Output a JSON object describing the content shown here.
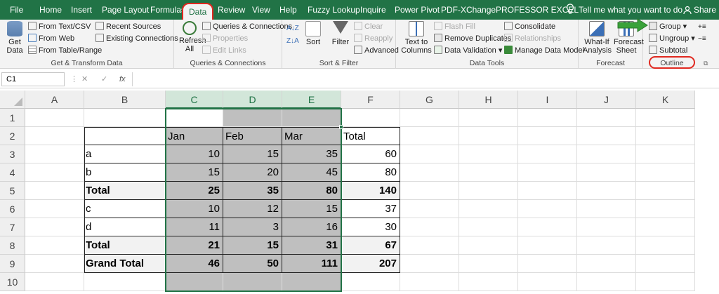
{
  "menubar": {
    "tabs": [
      "File",
      "Home",
      "Insert",
      "Page Layout",
      "Formulas",
      "Data",
      "Review",
      "View",
      "Help",
      "Fuzzy Lookup",
      "Inquire",
      "Power Pivot",
      "PDF-XChange",
      "PROFESSOR EXCEL"
    ],
    "tell_me": "Tell me what you want to do",
    "share": "Share"
  },
  "ribbon": {
    "get_transform": {
      "get_data": "Get Data",
      "from_text_csv": "From Text/CSV",
      "from_web": "From Web",
      "from_table_range": "From Table/Range",
      "recent_sources": "Recent Sources",
      "existing_connections": "Existing Connections",
      "label": "Get & Transform Data"
    },
    "queries": {
      "refresh_all": "Refresh All",
      "queries_connections": "Queries & Connections",
      "properties": "Properties",
      "edit_links": "Edit Links",
      "label": "Queries & Connections"
    },
    "sort_filter": {
      "sort": "Sort",
      "filter": "Filter",
      "clear": "Clear",
      "reapply": "Reapply",
      "advanced": "Advanced",
      "label": "Sort & Filter"
    },
    "data_tools": {
      "text_to_columns": "Text to Columns",
      "flash_fill": "Flash Fill",
      "remove_duplicates": "Remove Duplicates",
      "data_validation": "Data Validation",
      "consolidate": "Consolidate",
      "relationships": "Relationships",
      "manage_data_model": "Manage Data Model",
      "label": "Data Tools"
    },
    "forecast": {
      "what_if": "What-If Analysis",
      "forecast_sheet": "Forecast Sheet",
      "label": "Forecast"
    },
    "outline": {
      "group": "Group",
      "ungroup": "Ungroup",
      "subtotal": "Subtotal",
      "label": "Outline"
    }
  },
  "formula_bar": {
    "name_box": "C1",
    "fx": "fx",
    "content": ""
  },
  "columns": [
    "A",
    "B",
    "C",
    "D",
    "E",
    "F",
    "G",
    "H",
    "I",
    "J",
    "K"
  ],
  "rows": [
    "1",
    "2",
    "3",
    "4",
    "5",
    "6",
    "7",
    "8",
    "9",
    "10"
  ],
  "table": {
    "header": [
      "",
      "Jan",
      "Feb",
      "Mar",
      "Total"
    ],
    "rows": [
      {
        "label": "a",
        "jan": "10",
        "feb": "15",
        "mar": "35",
        "total": "60",
        "bold": false
      },
      {
        "label": "b",
        "jan": "15",
        "feb": "20",
        "mar": "45",
        "total": "80",
        "bold": false
      },
      {
        "label": "Total",
        "jan": "25",
        "feb": "35",
        "mar": "80",
        "total": "140",
        "bold": true
      },
      {
        "label": "c",
        "jan": "10",
        "feb": "12",
        "mar": "15",
        "total": "37",
        "bold": false
      },
      {
        "label": "d",
        "jan": "11",
        "feb": "3",
        "mar": "16",
        "total": "30",
        "bold": false
      },
      {
        "label": "Total",
        "jan": "21",
        "feb": "15",
        "mar": "31",
        "total": "67",
        "bold": true
      },
      {
        "label": "Grand Total",
        "jan": "46",
        "feb": "50",
        "mar": "111",
        "total": "207",
        "bold": true
      }
    ]
  },
  "colors": {
    "excel_green": "#217346",
    "highlight_red": "#e0281f",
    "selection_gray": "#bfbfbf",
    "arrow_green": "#3aa23a"
  }
}
